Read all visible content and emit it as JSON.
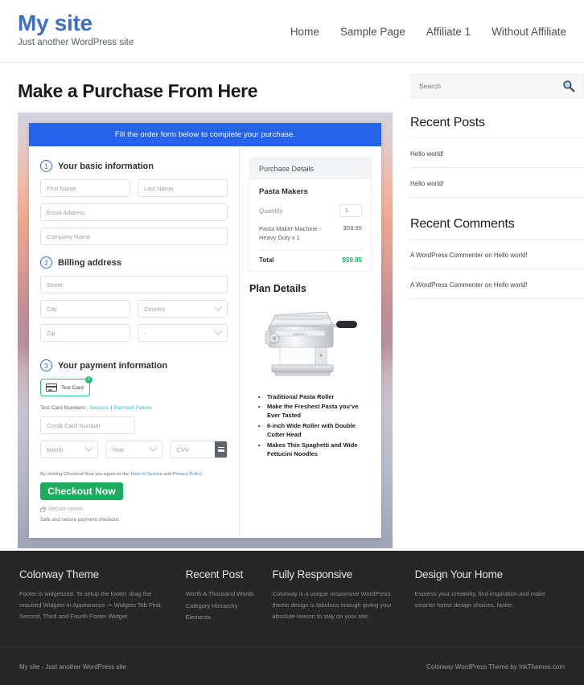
{
  "header": {
    "site_title": "My site",
    "tagline": "Just another WordPress site",
    "nav": [
      {
        "label": "Home"
      },
      {
        "label": "Sample Page"
      },
      {
        "label": "Affiliate 1"
      },
      {
        "label": "Without Affiliate"
      }
    ]
  },
  "main": {
    "page_title": "Make a Purchase From Here",
    "order_form": {
      "banner": "Fill the order form below to complete your purchase.",
      "steps": [
        {
          "num": "1",
          "label": "Your basic information"
        },
        {
          "num": "2",
          "label": "Billing address"
        },
        {
          "num": "3",
          "label": "Your payment information"
        }
      ],
      "fields": {
        "first_name": "First Name",
        "last_name": "Last Name",
        "email": "Email Address",
        "company": "Company Name",
        "street": "Street",
        "city": "City",
        "country": "Country",
        "zip": "Zip",
        "state": "-",
        "credit_card": "Credit Card Number",
        "month": "Month",
        "year": "Year",
        "cvv": "CVV"
      },
      "payment": {
        "card_option_label": "Test Card",
        "check_glyph": "✓",
        "test_numbers_prefix": "Test Card Numbers :",
        "test_success": "Success",
        "test_divider": "|",
        "test_failure": "Payment Failure",
        "terms_prefix": "By clicking Checkout Now you agree to the",
        "terms_link": "Term of Service",
        "terms_and": "and",
        "privacy_link": "Privacy Policy",
        "checkout_label": "Checkout Now",
        "secure_server": "Secure server",
        "safe_text": "Safe and secure payment checkout."
      }
    },
    "purchase_details": {
      "heading": "Purchase Details",
      "product_name": "Pasta Makers",
      "quantity_label": "Quantity",
      "quantity_value": "1",
      "line_item_name": "Pasta Maker Machine - Heavy Duty x 1",
      "line_item_price": "$59.95",
      "total_label": "Total",
      "total_value": "$59.95",
      "total_color": "#1faa5f"
    },
    "plan_details": {
      "heading": "Plan Details",
      "image_alt": "pasta-maker-machine-image",
      "bullets": [
        "Traditional Pasta Roller",
        "Make the Freshest Pasta you’ve Ever Tasted",
        "6-inch Wide Roller with Double Cutter Head",
        "Makes Thin Spaghetti and Wide Fettucini Noodles"
      ]
    }
  },
  "sidebar": {
    "search": {
      "placeholder": "Search",
      "icon": "search-icon"
    },
    "widgets": [
      {
        "title": "Recent Posts",
        "items": [
          {
            "label": "Hello world!"
          },
          {
            "label": "Hello world!"
          }
        ]
      },
      {
        "title": "Recent Comments",
        "items": [
          {
            "label": "A WordPress Commenter on Hello world!"
          },
          {
            "label": "A WordPress Commenter on Hello world!"
          }
        ]
      }
    ]
  },
  "footer": {
    "columns": [
      {
        "title": "Colorway Theme",
        "text": "Footer is widgetized. To setup the footer, drag the required Widgets in Appearance -> Widgets Tab First, Second, Third and Fourth Footer Widget"
      },
      {
        "title": "Recent Post",
        "items": [
          {
            "label": "Worth A Thousand Words"
          },
          {
            "label": "Category Hierarchy"
          },
          {
            "label": "Elements"
          }
        ]
      },
      {
        "title": "Fully Responsive",
        "text": "Colorway is a unique responsive WordPress theme design is fabulous enough giving your absolute reason to stay on your site."
      },
      {
        "title": "Design Your Home",
        "text": "Express your creativity, find inspiration and make smarter home design choices, faster."
      }
    ],
    "bottom_left": "My site - Just another WordPress site",
    "bottom_right": "Colorway WordPress Theme by InkThemes.com"
  },
  "colors": {
    "brand": "#3f6fc4",
    "banner_blue": "#2563eb",
    "success_green": "#1faa5f",
    "link_teal": "#3fb8c4",
    "footer_bg": "#262626"
  }
}
